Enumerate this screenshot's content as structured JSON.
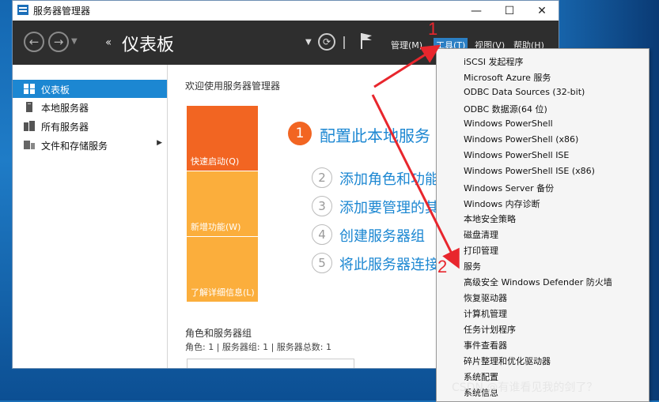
{
  "window": {
    "title": "服务器管理器",
    "controls": {
      "minimize": "—",
      "maximize": "☐",
      "close": "✕"
    }
  },
  "toolbar": {
    "back_glyph": "←",
    "forward_glyph": "→",
    "breadcrumb_arrows": "‹‹",
    "breadcrumb_title": "仪表板",
    "menus": {
      "manage": "管理(M)",
      "tools": "工具(T)",
      "view": "视图(V)",
      "help": "帮助(H)"
    }
  },
  "sidebar": {
    "items": [
      {
        "label": "仪表板",
        "icon": "dashboard-icon",
        "selected": true
      },
      {
        "label": "本地服务器",
        "icon": "server-icon",
        "selected": false
      },
      {
        "label": "所有服务器",
        "icon": "servers-icon",
        "selected": false
      },
      {
        "label": "文件和存储服务",
        "icon": "storage-icon",
        "selected": false,
        "has_arrow": true
      }
    ]
  },
  "main": {
    "welcome": "欢迎使用服务器管理器",
    "tiles": {
      "quick_start": "快速启动(Q)",
      "whats_new": "新增功能(W)",
      "learn_more": "了解详细信息(L)"
    },
    "steps": [
      {
        "num": "1",
        "text": "配置此本地服务"
      },
      {
        "num": "2",
        "text": "添加角色和功能"
      },
      {
        "num": "3",
        "text": "添加要管理的其他"
      },
      {
        "num": "4",
        "text": "创建服务器组"
      },
      {
        "num": "5",
        "text": "将此服务器连接"
      }
    ],
    "roles_title": "角色和服务器组",
    "roles_sub": "角色: 1 | 服务器组: 1 | 服务器总数: 1"
  },
  "tools_menu": {
    "items": [
      "iSCSI 发起程序",
      "Microsoft Azure 服务",
      "ODBC Data Sources (32-bit)",
      "ODBC 数据源(64 位)",
      "Windows PowerShell",
      "Windows PowerShell (x86)",
      "Windows PowerShell ISE",
      "Windows PowerShell ISE (x86)",
      "Windows Server 备份",
      "Windows 内存诊断",
      "本地安全策略",
      "磁盘清理",
      "打印管理",
      "服务",
      "高级安全 Windows Defender 防火墙",
      "恢复驱动器",
      "计算机管理",
      "任务计划程序",
      "事件查看器",
      "碎片整理和优化驱动器",
      "系统配置",
      "系统信息"
    ]
  },
  "annotations": {
    "label_1": "1",
    "label_2": "2",
    "color": "#e8262d"
  },
  "watermark": "CSDN @有谁看见我的剑了？",
  "colors": {
    "toolbar_bg": "#2e2e2e",
    "accent_blue": "#1c87d2",
    "tile_orange": "#f26522",
    "tile_amber": "#fbae3c",
    "step_orange": "#f26522",
    "step_blue": "#1c87d2"
  }
}
